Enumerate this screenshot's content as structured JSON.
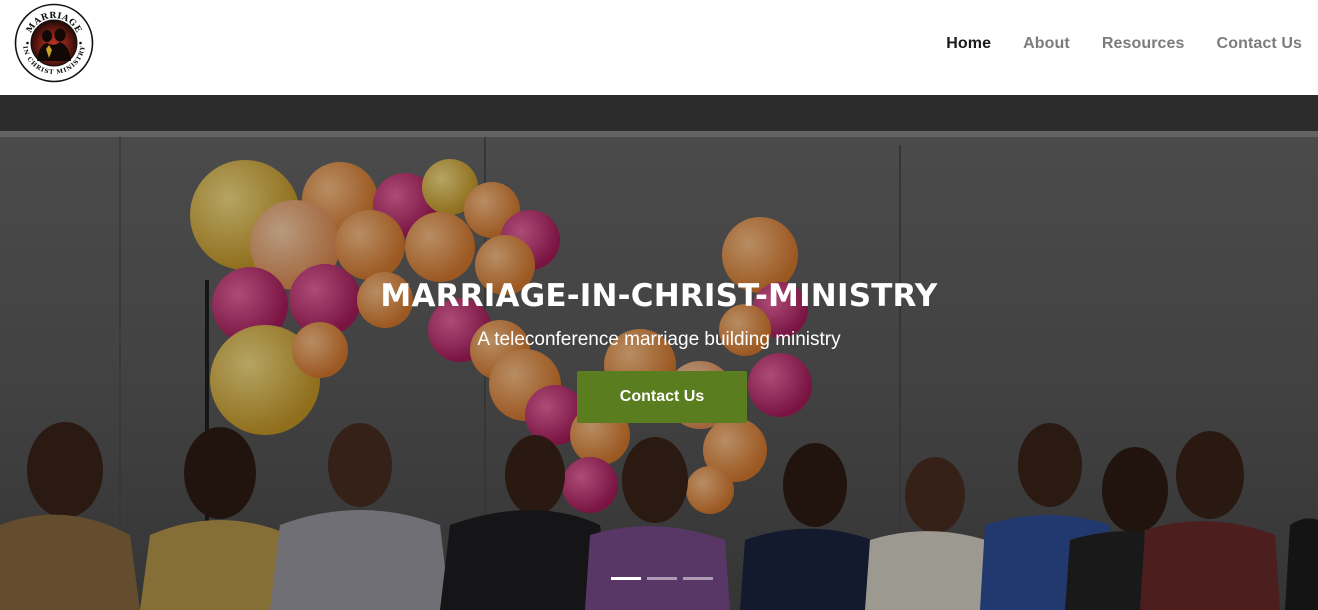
{
  "logo": {
    "name": "MARRIAGE IN CHRIST MINISTRY",
    "top_text": "MARRIAGE",
    "bottom_text": "IN CHRIST MINISTRY"
  },
  "nav": {
    "items": [
      {
        "label": "Home",
        "active": true
      },
      {
        "label": "About",
        "active": false
      },
      {
        "label": "Resources",
        "active": false
      },
      {
        "label": "Contact Us",
        "active": false
      }
    ]
  },
  "hero": {
    "title": "MARRIAGE-IN-CHRIST-MINISTRY",
    "subtitle": "A teleconference marriage building ministry",
    "button_label": "Contact Us",
    "button_color": "#5a7d20",
    "slides_total": 3,
    "active_slide": 1
  }
}
